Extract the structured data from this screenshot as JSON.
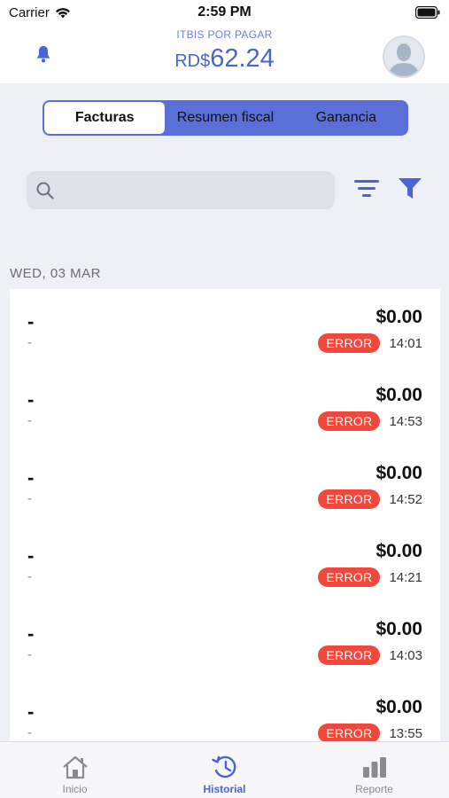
{
  "status_bar": {
    "carrier": "Carrier",
    "time": "2:59 PM"
  },
  "header": {
    "label": "ITBIS POR PAGAR",
    "currency": "RD$",
    "amount": "62.24"
  },
  "segments": [
    {
      "label": "Facturas",
      "active": true
    },
    {
      "label": "Resumen fiscal",
      "active": false
    },
    {
      "label": "Ganancia",
      "active": false
    }
  ],
  "search": {
    "placeholder": ""
  },
  "date_group": "WED, 03 MAR",
  "rows": [
    {
      "title": "-",
      "subtitle": "-",
      "amount": "$0.00",
      "status": "ERROR",
      "time": "14:01"
    },
    {
      "title": "-",
      "subtitle": "-",
      "amount": "$0.00",
      "status": "ERROR",
      "time": "14:53"
    },
    {
      "title": "-",
      "subtitle": "-",
      "amount": "$0.00",
      "status": "ERROR",
      "time": "14:52"
    },
    {
      "title": "-",
      "subtitle": "-",
      "amount": "$0.00",
      "status": "ERROR",
      "time": "14:21"
    },
    {
      "title": "-",
      "subtitle": "-",
      "amount": "$0.00",
      "status": "ERROR",
      "time": "14:03"
    },
    {
      "title": "-",
      "subtitle": "-",
      "amount": "$0.00",
      "status": "ERROR",
      "time": "13:55"
    }
  ],
  "tabs": [
    {
      "label": "Inicio",
      "icon": "home-icon",
      "active": false
    },
    {
      "label": "Historial",
      "icon": "history-icon",
      "active": true
    },
    {
      "label": "Reporte",
      "icon": "bar-chart-icon",
      "active": false
    }
  ],
  "colors": {
    "accent": "#4a63d6",
    "segment_bg": "#5a6fd8",
    "error": "#f2483b"
  }
}
